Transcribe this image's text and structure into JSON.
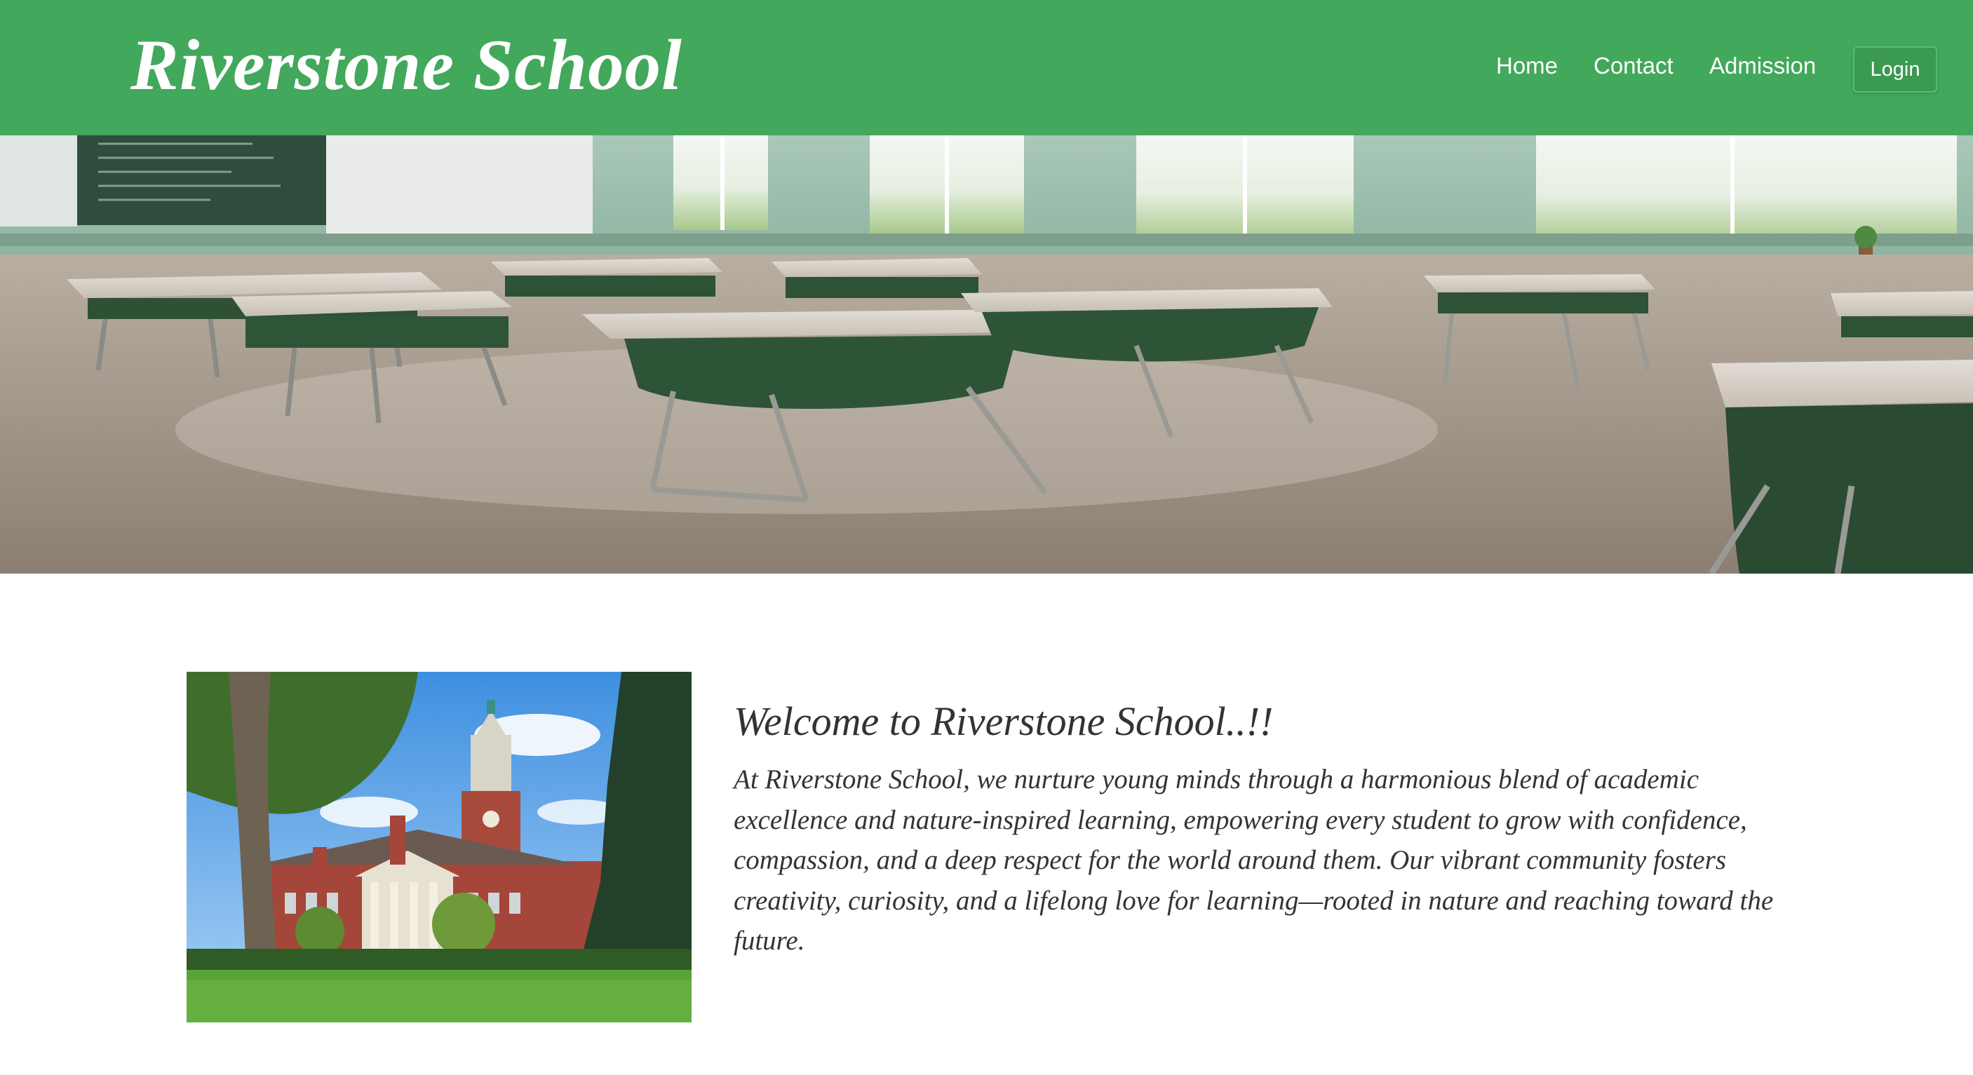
{
  "header": {
    "brand": "Riverstone School",
    "nav": {
      "home": "Home",
      "contact": "Contact",
      "admission": "Admission"
    },
    "login_label": "Login"
  },
  "theme": {
    "header_green": "#42a85b",
    "text_dark": "#333333"
  },
  "intro": {
    "heading": "Welcome to Riverstone School..!!",
    "paragraph": "At Riverstone School, we nurture young minds through a harmonious blend of academic excellence and nature-inspired learning, empowering every student to grow with confidence, compassion, and a deep respect for the world around them. Our vibrant community fosters creativity, curiosity, and a lifelong love for learning—rooted in nature and reaching toward the future."
  }
}
